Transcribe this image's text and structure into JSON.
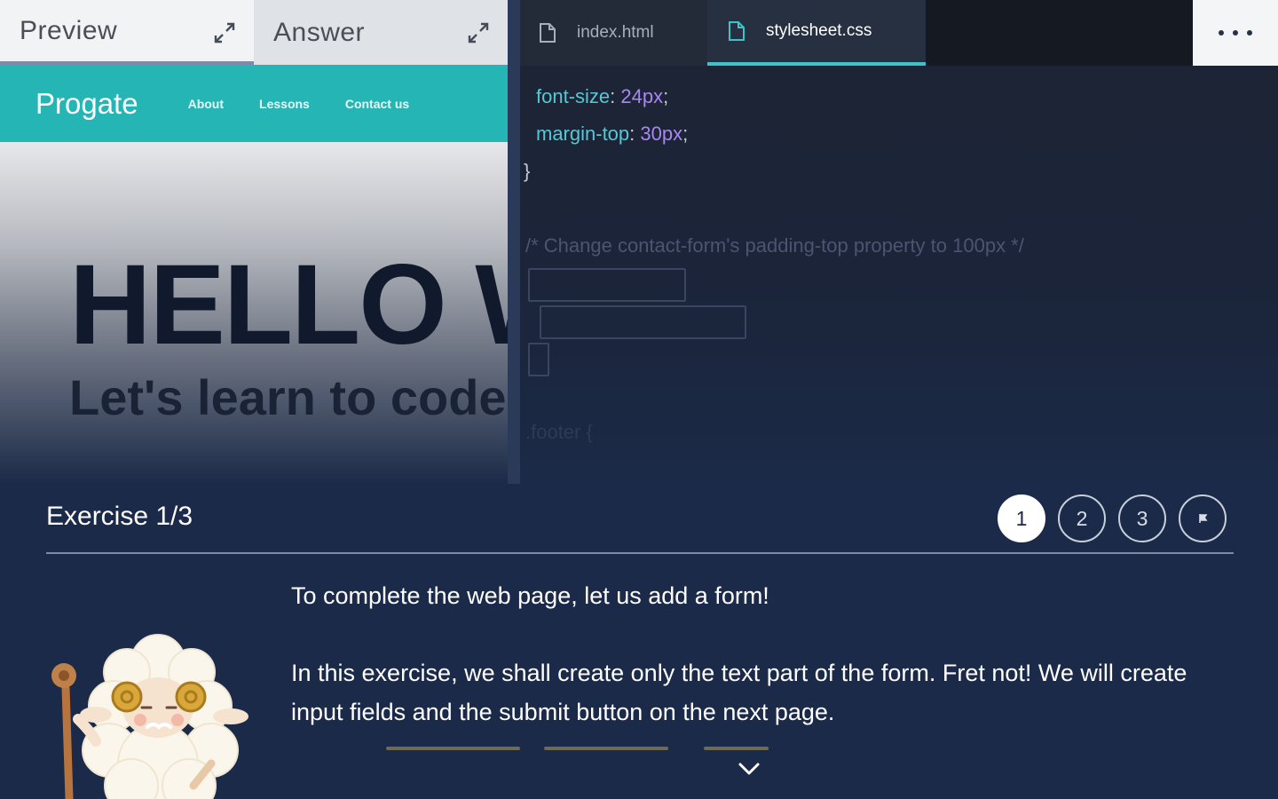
{
  "preview_panel": {
    "tabs": [
      {
        "label": "Preview",
        "active": true
      },
      {
        "label": "Answer",
        "active": false
      }
    ],
    "site": {
      "logo": "Progate",
      "nav_links": [
        "About",
        "Lessons",
        "Contact us"
      ],
      "hero_title": "HELLO W",
      "hero_subtitle": "Let's learn to code",
      "nav_color": "#26b5b5"
    }
  },
  "editor": {
    "file_tabs": [
      {
        "label": "index.html",
        "active": false
      },
      {
        "label": "stylesheet.css",
        "active": true
      }
    ],
    "code": {
      "line1_prop": "font-size",
      "line1_colon": ": ",
      "line1_value": "24px",
      "line1_semi": ";",
      "line2_prop": "margin-top",
      "line2_colon": ": ",
      "line2_value": "30px",
      "line2_semi": ";",
      "closing_brace": "}",
      "comment": "/* Change contact-form's padding-top property to 100px */",
      "footer_selector": ".footer {"
    },
    "accent_color": "#3ec3c9"
  },
  "exercise": {
    "title": "Exercise 1/3",
    "steps": [
      "1",
      "2",
      "3",
      "⚑"
    ],
    "current_step": 1,
    "instruction_1": "To complete the web page, let us add a form!",
    "instruction_2": "In this exercise, we shall create only the text part of the form. Fret not! We will create input fields and the submit button on the next page.",
    "mascot": "sheep-mascot-icon"
  }
}
